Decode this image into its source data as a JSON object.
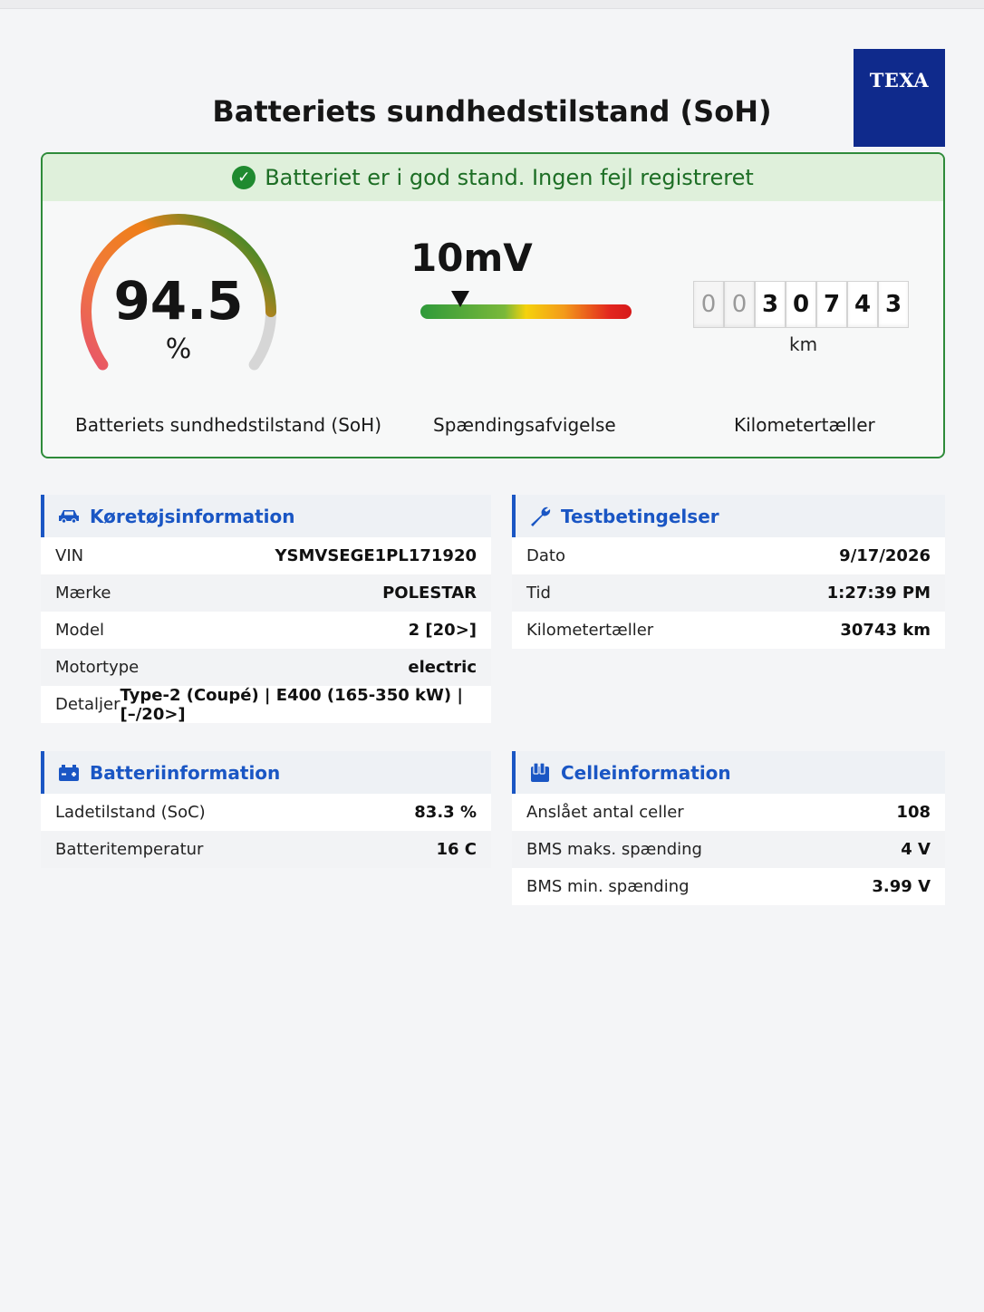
{
  "brand": {
    "logo_text": "TEXA",
    "logo_color": "#0f2a8c"
  },
  "page_title": "Batteriets sundhedstilstand (SoH)",
  "status": {
    "icon": "check-circle-icon",
    "message": "Batteriet er i god stand. Ingen fejl registreret",
    "color": "#1d6e25"
  },
  "metrics": {
    "soh": {
      "value": "94.5",
      "unit": "%",
      "label": "Batteriets sundhedstilstand (SoH)",
      "percent": 94.5
    },
    "voltage_deviation": {
      "value": "10mV",
      "label": "Spændingsafvigelse",
      "marker_fraction": 0.19
    },
    "odometer": {
      "digits": [
        "0",
        "0",
        "3",
        "0",
        "7",
        "4",
        "3"
      ],
      "unit": "km",
      "label": "Kilometertæller"
    }
  },
  "vehicle": {
    "title": "Køretøjsinformation",
    "icon": "car-icon",
    "rows": [
      {
        "label": "VIN",
        "value": "YSMVSEGE1PL171920"
      },
      {
        "label": "Mærke",
        "value": "POLESTAR"
      },
      {
        "label": "Model",
        "value": "2 [20>]"
      },
      {
        "label": "Motortype",
        "value": "electric"
      },
      {
        "label": "Detaljer",
        "value": "Type-2 (Coupé) | E400 (165-350 kW) | [–/20>]"
      }
    ]
  },
  "test_conditions": {
    "title": "Testbetingelser",
    "icon": "wrench-icon",
    "rows": [
      {
        "label": "Dato",
        "value": "9/17/2026"
      },
      {
        "label": "Tid",
        "value": "1:27:39 PM"
      },
      {
        "label": "Kilometertæller",
        "value": "30743 km"
      }
    ]
  },
  "battery": {
    "title": "Batteriinformation",
    "icon": "battery-icon",
    "rows": [
      {
        "label": "Ladetilstand (SoC)",
        "value": "83.3 %"
      },
      {
        "label": "Batteritemperatur",
        "value": "16 C"
      }
    ]
  },
  "cells": {
    "title": "Celleinformation",
    "icon": "cells-icon",
    "rows": [
      {
        "label": "Anslået antal celler",
        "value": "108"
      },
      {
        "label": "BMS maks. spænding",
        "value": "4 V"
      },
      {
        "label": "BMS min. spænding",
        "value": "3.99 V"
      }
    ]
  }
}
